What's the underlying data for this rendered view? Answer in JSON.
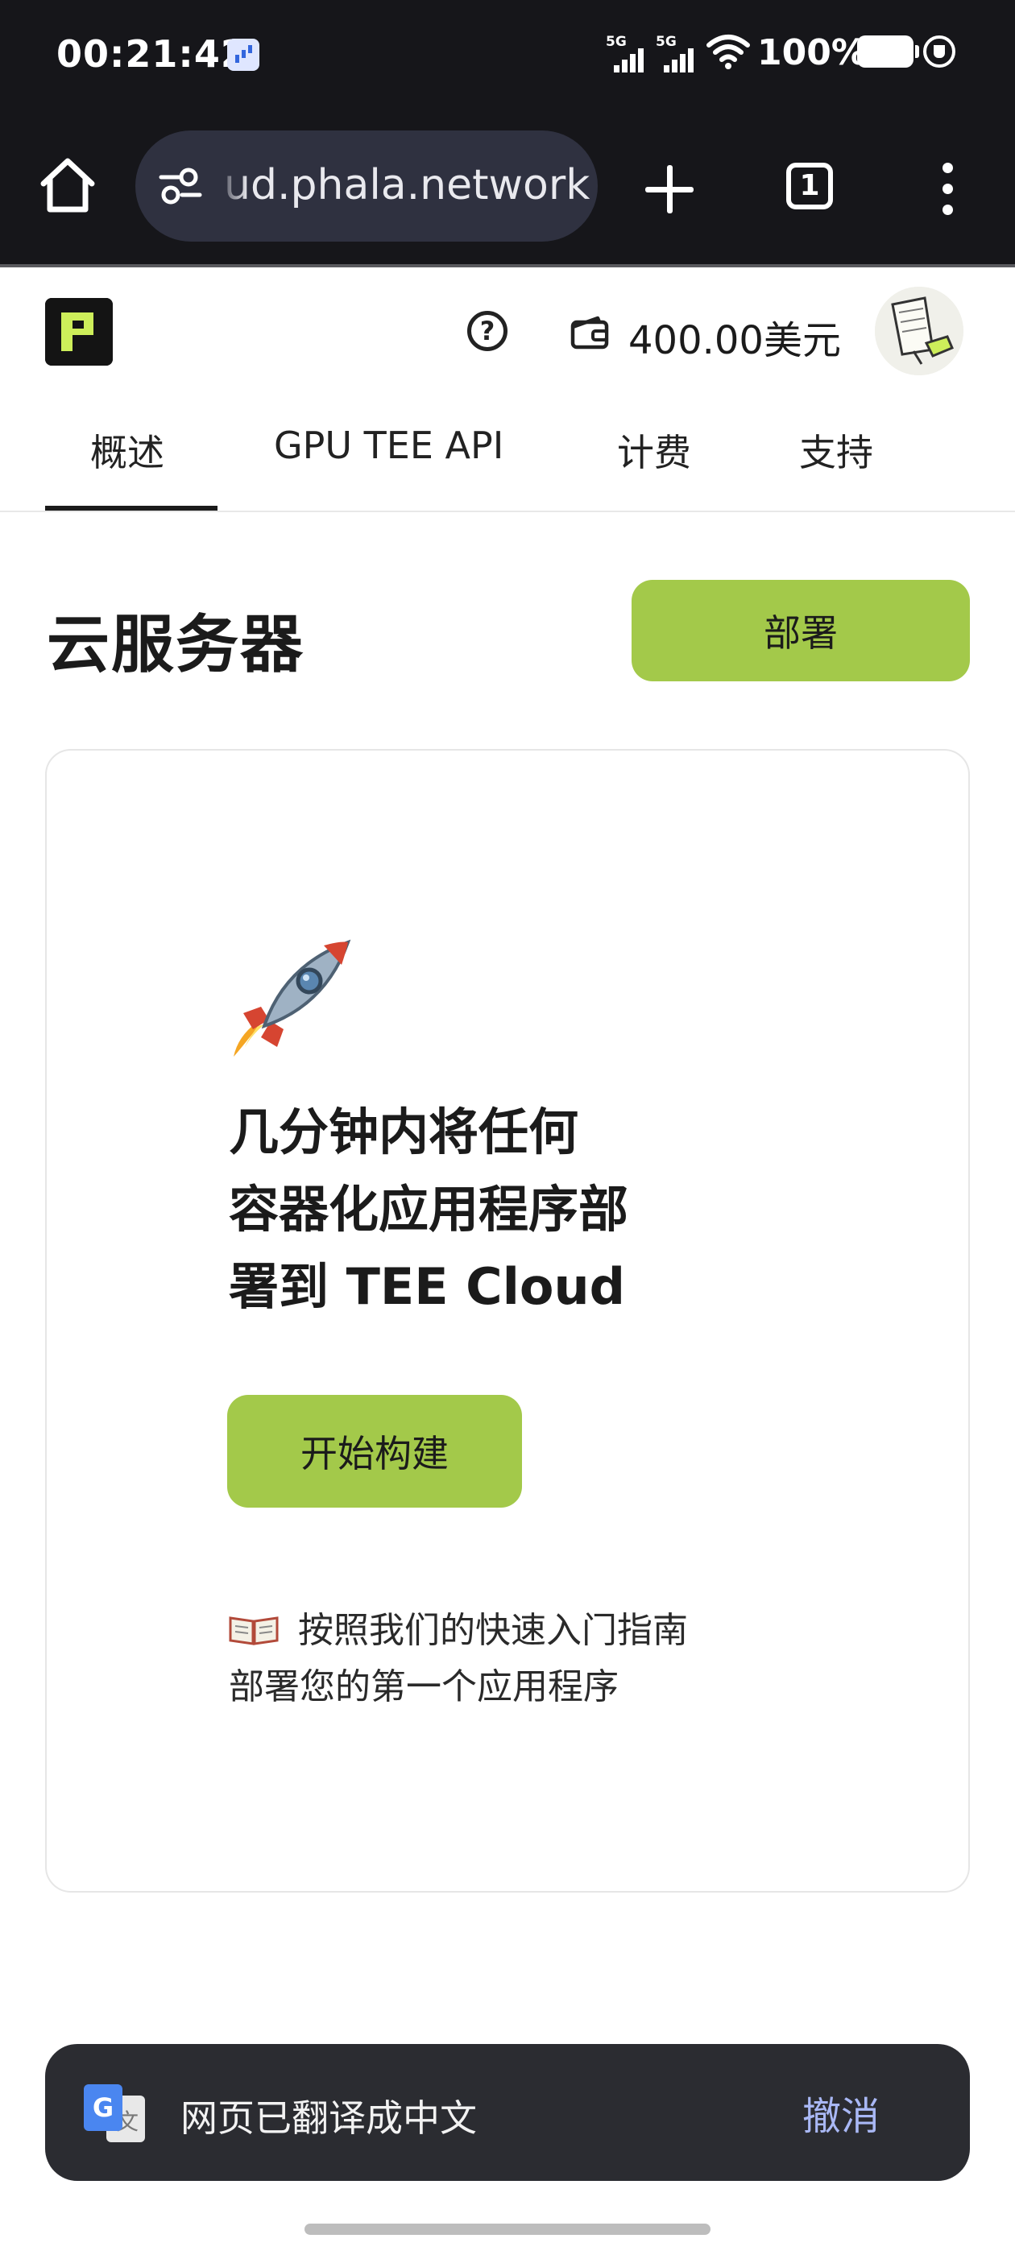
{
  "status_bar": {
    "time": "00:21:42",
    "network_1": "5G",
    "network_2": "5G",
    "battery": "100%"
  },
  "browser": {
    "url": "ud.phala.network",
    "tab_count": "1",
    "icons": [
      "home-icon",
      "tune-icon",
      "plus-icon",
      "tabs-icon",
      "more-vert-icon"
    ]
  },
  "header": {
    "balance": "400.00美元",
    "icons": [
      "logo",
      "help-icon",
      "wallet-icon",
      "avatar"
    ]
  },
  "nav": {
    "tabs": [
      {
        "label": "概述",
        "active": true
      },
      {
        "label": "GPU TEE API",
        "active": false
      },
      {
        "label": "计费",
        "active": false
      },
      {
        "label": "支持",
        "active": false
      }
    ]
  },
  "page": {
    "title": "云服务器",
    "deploy_label": "部署"
  },
  "card": {
    "headline_lines": [
      "几分钟内将任何",
      "容器化应用程序部",
      "署到 TEE Cloud"
    ],
    "start_label": "开始构建",
    "guide_lines": [
      "按照我们的快速入门指南",
      "部署您的第一个应用程序"
    ],
    "icons": [
      "rocket-icon",
      "book-icon"
    ]
  },
  "toast": {
    "message": "网页已翻译成中文",
    "undo_label": "撤消"
  },
  "colors": {
    "accent_green": "#a3c94a",
    "dark_bar": "#16161a",
    "toast_bg": "#2b2c31",
    "undo_link": "#a9b8f5"
  }
}
